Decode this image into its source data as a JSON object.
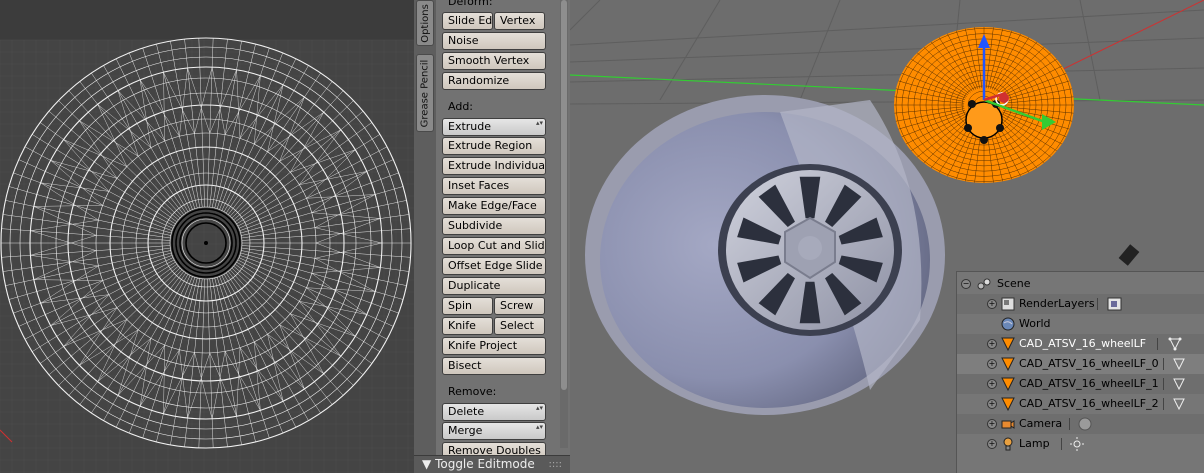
{
  "tool_panel": {
    "tabs": [
      "Options",
      "Grease Pencil"
    ],
    "deform_label": "Deform:",
    "deform_buttons": {
      "slide_edge": "Slide Ed",
      "vertex": "Vertex",
      "noise": "Noise",
      "smooth_vertex": "Smooth Vertex",
      "randomize": "Randomize"
    },
    "add_label": "Add:",
    "add_buttons": {
      "extrude": "Extrude",
      "extrude_region": "Extrude Region",
      "extrude_individual": "Extrude Individual",
      "inset_faces": "Inset Faces",
      "make_edge_face": "Make Edge/Face",
      "subdivide": "Subdivide",
      "loop_cut_and_slide": "Loop Cut and Slide",
      "offset_edge_slide": "Offset Edge Slide",
      "duplicate": "Duplicate",
      "spin": "Spin",
      "screw": "Screw",
      "knife": "Knife",
      "select": "Select",
      "knife_project": "Knife Project",
      "bisect": "Bisect"
    },
    "remove_label": "Remove:",
    "remove_buttons": {
      "delete": "Delete",
      "merge": "Merge",
      "remove_doubles": "Remove Doubles"
    },
    "toggle_editmode": "Toggle Editmode"
  },
  "outliner": {
    "items": [
      {
        "name": "Scene",
        "icon": "scene-icon"
      },
      {
        "name": "RenderLayers",
        "icon": "render-layers-icon"
      },
      {
        "name": "World",
        "icon": "world-icon"
      },
      {
        "name": "CAD_ATSV_16_wheelLF",
        "icon": "mesh-object-icon"
      },
      {
        "name": "CAD_ATSV_16_wheelLF_0",
        "icon": "mesh-object-icon"
      },
      {
        "name": "CAD_ATSV_16_wheelLF_1",
        "icon": "mesh-object-icon"
      },
      {
        "name": "CAD_ATSV_16_wheelLF_2",
        "icon": "mesh-object-icon"
      },
      {
        "name": "Camera",
        "icon": "camera-icon"
      },
      {
        "name": "Lamp",
        "icon": "lamp-icon"
      }
    ]
  },
  "colors": {
    "selection_orange": "#ff8c00",
    "button_face": "#d9d3cb",
    "panel_bg": "#727272",
    "viewport_bg": "#6d6d6d",
    "axis_green": "#33cc33",
    "axis_red": "#d03030",
    "axis_blue": "#2255ff"
  }
}
